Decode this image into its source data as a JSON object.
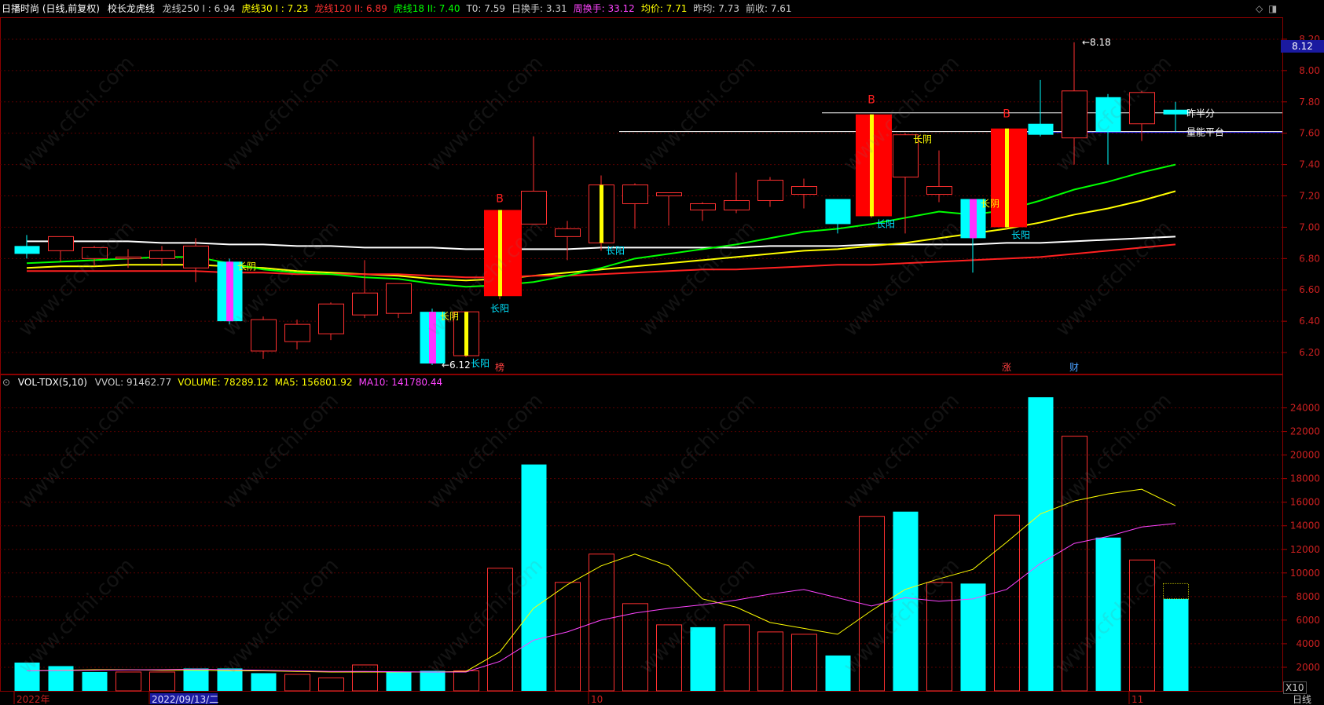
{
  "header": {
    "stock": "日播时尚 (日线,前复权)",
    "indicator": "校长龙虎线",
    "items": [
      {
        "label": "龙线250 I : 6.94",
        "color": "#cccccc"
      },
      {
        "label": "虎线30 I : 7.23",
        "color": "#ffff00"
      },
      {
        "label": "龙线120 II: 6.89",
        "color": "#ff3030"
      },
      {
        "label": "虎线18 II: 7.40",
        "color": "#00ff00"
      },
      {
        "label": "T0: 7.59",
        "color": "#cccccc"
      },
      {
        "label": "日换手: 3.31",
        "color": "#cccccc"
      },
      {
        "label": "周换手: 33.12",
        "color": "#ff44ff"
      },
      {
        "label": "均价: 7.71",
        "color": "#ffff00"
      },
      {
        "label": "昨均: 7.73",
        "color": "#cccccc"
      },
      {
        "label": "前收: 7.61",
        "color": "#cccccc"
      }
    ]
  },
  "volume_header": {
    "indicator": "VOL-TDX(5,10)",
    "items": [
      {
        "label": "VVOL: 91462.77",
        "color": "#cccccc"
      },
      {
        "label": "VOLUME: 78289.12",
        "color": "#ffff00"
      },
      {
        "label": "MA5: 156801.92",
        "color": "#ffff00"
      },
      {
        "label": "MA10: 141780.44",
        "color": "#ff44ff"
      }
    ]
  },
  "price_badge": "8.12",
  "bottom_right": "日线",
  "zoom_label": "X10",
  "x_axis_labels": [
    {
      "text": "2022年",
      "bar": 0
    },
    {
      "text": "2022/09/13/二",
      "bar": 4
    },
    {
      "text": "10",
      "bar": 17
    },
    {
      "text": "11",
      "bar": 33
    }
  ],
  "watermark": "www.cfchi.com",
  "chart_data": [
    {
      "type": "candlestick",
      "title": "",
      "ylim": [
        6.07,
        8.33
      ],
      "y_ticks": [
        6.2,
        6.4,
        6.6,
        6.8,
        7.0,
        7.2,
        7.4,
        7.6,
        7.8,
        8.0,
        8.2
      ],
      "candles": [
        {
          "o": 6.88,
          "h": 6.95,
          "l": 6.8,
          "c": 6.83
        },
        {
          "o": 6.85,
          "h": 6.94,
          "l": 6.78,
          "c": 6.94
        },
        {
          "o": 6.8,
          "h": 6.88,
          "l": 6.75,
          "c": 6.87
        },
        {
          "o": 6.8,
          "h": 6.86,
          "l": 6.74,
          "c": 6.81
        },
        {
          "o": 6.8,
          "h": 6.88,
          "l": 6.75,
          "c": 6.85
        },
        {
          "o": 6.74,
          "h": 6.93,
          "l": 6.65,
          "c": 6.88
        },
        {
          "o": 6.78,
          "h": 6.8,
          "l": 6.38,
          "c": 6.4
        },
        {
          "o": 6.21,
          "h": 6.43,
          "l": 6.16,
          "c": 6.41
        },
        {
          "o": 6.27,
          "h": 6.41,
          "l": 6.22,
          "c": 6.38
        },
        {
          "o": 6.32,
          "h": 6.52,
          "l": 6.28,
          "c": 6.51
        },
        {
          "o": 6.44,
          "h": 6.79,
          "l": 6.42,
          "c": 6.58
        },
        {
          "o": 6.45,
          "h": 6.64,
          "l": 6.42,
          "c": 6.64
        },
        {
          "o": 6.46,
          "h": 6.48,
          "l": 6.12,
          "c": 6.13
        },
        {
          "o": 6.18,
          "h": 6.46,
          "l": 6.17,
          "c": 6.46
        },
        {
          "o": 6.56,
          "h": 7.11,
          "l": 6.54,
          "c": 7.11
        },
        {
          "o": 7.02,
          "h": 7.58,
          "l": 7.02,
          "c": 7.23
        },
        {
          "o": 6.94,
          "h": 7.04,
          "l": 6.79,
          "c": 6.99
        },
        {
          "o": 6.9,
          "h": 7.33,
          "l": 6.85,
          "c": 7.27
        },
        {
          "o": 7.15,
          "h": 7.28,
          "l": 6.99,
          "c": 7.27
        },
        {
          "o": 7.2,
          "h": 7.22,
          "l": 7.01,
          "c": 7.22
        },
        {
          "o": 7.11,
          "h": 7.16,
          "l": 7.04,
          "c": 7.15
        },
        {
          "o": 7.11,
          "h": 7.35,
          "l": 7.09,
          "c": 7.17
        },
        {
          "o": 7.17,
          "h": 7.32,
          "l": 7.13,
          "c": 7.3
        },
        {
          "o": 7.21,
          "h": 7.31,
          "l": 7.12,
          "c": 7.26
        },
        {
          "o": 7.18,
          "h": 7.18,
          "l": 6.96,
          "c": 7.02
        },
        {
          "o": 7.07,
          "h": 7.72,
          "l": 7.06,
          "c": 7.72
        },
        {
          "o": 7.32,
          "h": 7.6,
          "l": 6.96,
          "c": 7.59
        },
        {
          "o": 7.21,
          "h": 7.49,
          "l": 7.16,
          "c": 7.26
        },
        {
          "o": 7.18,
          "h": 7.18,
          "l": 6.71,
          "c": 6.93
        },
        {
          "o": 7.0,
          "h": 7.63,
          "l": 6.99,
          "c": 7.63
        },
        {
          "o": 7.66,
          "h": 7.94,
          "l": 7.58,
          "c": 7.59
        },
        {
          "o": 7.57,
          "h": 8.18,
          "l": 7.4,
          "c": 7.87
        },
        {
          "o": 7.83,
          "h": 7.85,
          "l": 7.4,
          "c": 7.61
        },
        {
          "o": 7.66,
          "h": 7.87,
          "l": 7.55,
          "c": 7.86
        },
        {
          "o": 7.75,
          "h": 7.8,
          "l": 7.61,
          "c": 7.72
        }
      ],
      "series": [
        {
          "name": "龙线250",
          "color": "#ffffff",
          "values": [
            6.91,
            6.91,
            6.91,
            6.91,
            6.9,
            6.9,
            6.89,
            6.89,
            6.88,
            6.88,
            6.87,
            6.87,
            6.87,
            6.86,
            6.86,
            6.86,
            6.86,
            6.87,
            6.87,
            6.87,
            6.87,
            6.87,
            6.88,
            6.88,
            6.88,
            6.89,
            6.89,
            6.89,
            6.89,
            6.9,
            6.9,
            6.91,
            6.92,
            6.93,
            6.94
          ]
        },
        {
          "name": "虎线30",
          "color": "#ffff00",
          "values": [
            6.74,
            6.75,
            6.75,
            6.76,
            6.76,
            6.76,
            6.75,
            6.74,
            6.72,
            6.71,
            6.7,
            6.69,
            6.67,
            6.66,
            6.67,
            6.69,
            6.71,
            6.73,
            6.75,
            6.77,
            6.79,
            6.81,
            6.83,
            6.85,
            6.86,
            6.88,
            6.9,
            6.93,
            6.96,
            6.99,
            7.03,
            7.08,
            7.12,
            7.17,
            7.23
          ]
        },
        {
          "name": "龙线120",
          "color": "#ff2020",
          "values": [
            6.72,
            6.72,
            6.72,
            6.72,
            6.72,
            6.72,
            6.71,
            6.71,
            6.7,
            6.7,
            6.7,
            6.7,
            6.69,
            6.68,
            6.68,
            6.69,
            6.69,
            6.7,
            6.71,
            6.72,
            6.73,
            6.73,
            6.74,
            6.75,
            6.76,
            6.76,
            6.77,
            6.78,
            6.79,
            6.8,
            6.81,
            6.83,
            6.85,
            6.87,
            6.89
          ]
        },
        {
          "name": "虎线18",
          "color": "#00ff00",
          "values": [
            6.77,
            6.78,
            6.79,
            6.8,
            6.81,
            6.81,
            6.77,
            6.73,
            6.71,
            6.7,
            6.68,
            6.67,
            6.64,
            6.62,
            6.63,
            6.65,
            6.69,
            6.74,
            6.8,
            6.83,
            6.86,
            6.89,
            6.93,
            6.97,
            6.99,
            7.02,
            7.06,
            7.1,
            7.08,
            7.11,
            7.17,
            7.24,
            7.29,
            7.35,
            7.4
          ]
        }
      ],
      "hlines": [
        {
          "value": 7.73,
          "from_bar": 24,
          "color": "#ffffff"
        },
        {
          "value": 7.61,
          "from_bar": 18,
          "color": "#ffffff"
        }
      ],
      "annotations": [
        {
          "bar": 14,
          "text": "B",
          "color": "#ff2020",
          "pos": "above"
        },
        {
          "bar": 25,
          "text": "B",
          "color": "#ff2020",
          "pos": "above"
        },
        {
          "bar": 29,
          "text": "B",
          "color": "#ff2020",
          "pos": "above"
        },
        {
          "bar": 6,
          "text": "长阴",
          "color": "#ffff00",
          "pos": "right-top"
        },
        {
          "bar": 12,
          "text": "长阴",
          "color": "#ffff00",
          "pos": "right-top"
        },
        {
          "bar": 26,
          "text": "长阴",
          "color": "#ffff00",
          "pos": "right-top"
        },
        {
          "bar": 28,
          "text": "长阴",
          "color": "#ffff00",
          "pos": "right-top"
        },
        {
          "bar": 13,
          "text": "长阳",
          "color": "#00e5ff",
          "pos": "right-bottom"
        },
        {
          "bar": 14,
          "text": "长阳",
          "color": "#00e5ff",
          "pos": "below"
        },
        {
          "bar": 17,
          "text": "长阳",
          "color": "#00e5ff",
          "pos": "right-bottom"
        },
        {
          "bar": 25,
          "text": "长阳",
          "color": "#00e5ff",
          "pos": "right-bottom"
        },
        {
          "bar": 29,
          "text": "长阳",
          "color": "#00e5ff",
          "pos": "right-bottom"
        },
        {
          "bar": 12,
          "text": "←6.12",
          "color": "#ffffff",
          "pos": "low"
        },
        {
          "bar": 31,
          "text": "←8.18",
          "color": "#ffffff",
          "pos": "high"
        },
        {
          "bar": 34,
          "text": "昨半分",
          "color": "#ffffff",
          "pos": "line1"
        },
        {
          "bar": 34,
          "text": "量能平台",
          "color": "#ffffff",
          "pos": "line2"
        },
        {
          "bar": 14,
          "text": "榜",
          "color": "#ff4040",
          "pos": "bottom"
        },
        {
          "bar": 29,
          "text": "涨",
          "color": "#ff4040",
          "pos": "bottom"
        },
        {
          "bar": 31,
          "text": "财",
          "color": "#4aa0ff",
          "pos": "bottom"
        }
      ]
    },
    {
      "type": "bar",
      "title": "",
      "ylim": [
        0,
        25500
      ],
      "y_ticks": [
        2000,
        4000,
        6000,
        8000,
        10000,
        12000,
        14000,
        16000,
        18000,
        20000,
        22000,
        24000
      ],
      "series": [
        {
          "name": "VOLUME",
          "values": [
            2400,
            2100,
            1600,
            1600,
            1600,
            1900,
            1900,
            1500,
            1400,
            1100,
            2200,
            1600,
            1700,
            1700,
            10400,
            19200,
            9200,
            11600,
            7400,
            5600,
            5400,
            5600,
            5000,
            4800,
            3000,
            14800,
            15200,
            9200,
            9100,
            14900,
            24900,
            21600,
            13000,
            11100,
            7800
          ]
        },
        {
          "name": "MA5",
          "color": "#ffff00",
          "values": [
            1700,
            1750,
            1800,
            1800,
            1750,
            1750,
            1700,
            1700,
            1650,
            1600,
            1600,
            1600,
            1600,
            1650,
            3300,
            7000,
            9000,
            10600,
            11600,
            10600,
            7800,
            7100,
            5800,
            5300,
            4800,
            6800,
            8600,
            9500,
            10300,
            12600,
            15000,
            16100,
            16700,
            17100,
            15700
          ]
        },
        {
          "name": "MA10",
          "color": "#ff44ff",
          "values": [
            1700,
            1720,
            1750,
            1780,
            1800,
            1850,
            1800,
            1750,
            1700,
            1650,
            1650,
            1620,
            1600,
            1600,
            2500,
            4300,
            5000,
            6000,
            6600,
            7000,
            7300,
            7700,
            8200,
            8600,
            7900,
            7200,
            7900,
            7600,
            7800,
            8600,
            10800,
            12500,
            13100,
            13900,
            14200
          ]
        }
      ],
      "last_bar_prev_value": 9100,
      "up_flags": [
        false,
        false,
        false,
        true,
        true,
        false,
        false,
        false,
        true,
        true,
        true,
        false,
        false,
        true,
        true,
        false,
        true,
        true,
        true,
        true,
        false,
        true,
        true,
        true,
        false,
        true,
        false,
        true,
        false,
        true,
        false,
        true,
        false,
        true,
        false
      ]
    }
  ]
}
